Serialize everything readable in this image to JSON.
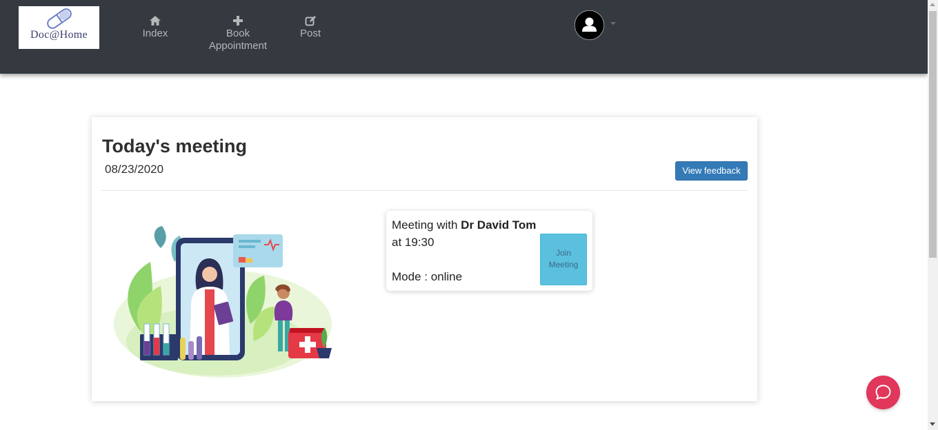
{
  "brand": {
    "logo_text": "Doc@Home"
  },
  "nav": {
    "items": [
      {
        "label": "Index",
        "icon": "home-icon"
      },
      {
        "label": "Book Appointment",
        "icon": "plus-icon"
      },
      {
        "label": "Post",
        "icon": "edit-icon"
      }
    ],
    "user_icon": "user-avatar-icon"
  },
  "card": {
    "title": "Today's meeting",
    "date": "08/23/2020",
    "feedback_button": "View feedback"
  },
  "meeting": {
    "prefix": "Meeting with ",
    "doctor": "Dr David Tom",
    "time": "at 19:30",
    "mode": "Mode : online",
    "join_button": "Join Meeting"
  },
  "chat": {
    "icon": "chat-bubble-icon"
  },
  "colors": {
    "navbar": "#343a40",
    "primary_button": "#337ab7",
    "join_button": "#5bc0de",
    "chat_button": "#e0375a"
  }
}
